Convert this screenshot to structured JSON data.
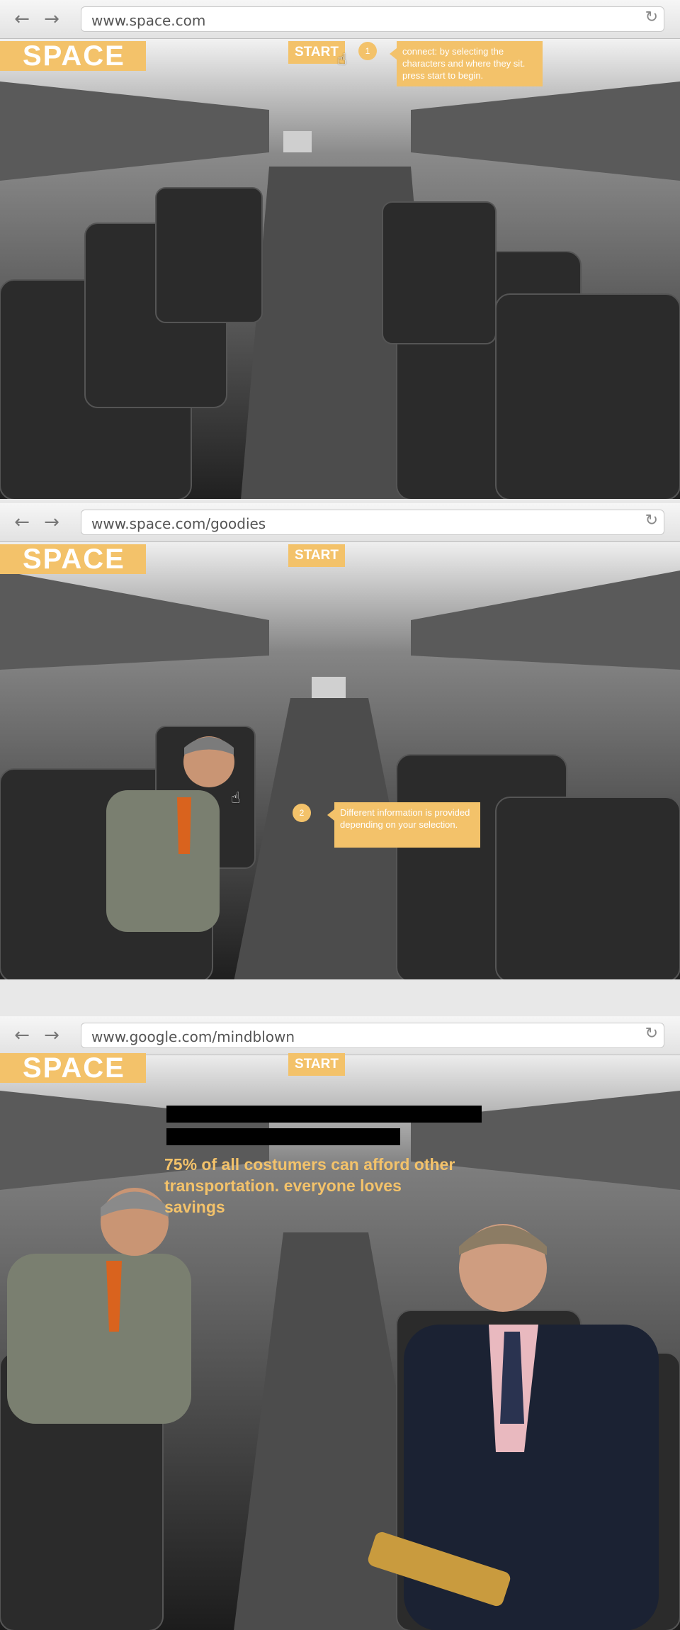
{
  "frames": [
    {
      "url": "www.space.com",
      "logo": "SPACE",
      "start_label": "START",
      "step": "1",
      "tooltip": "connect: by selecting the characters and where they sit. press start to begin."
    },
    {
      "url": "www.space.com/goodies",
      "logo": "SPACE",
      "start_label": "START",
      "step": "2",
      "tooltip": "Different information is provided depending on your selection."
    },
    {
      "url": "www.google.com/mindblown",
      "logo": "SPACE",
      "start_label": "START",
      "message": "75% of all costumers can afford other transportation. everyone loves savings"
    }
  ],
  "icons": {
    "back": "arrow-left",
    "forward": "arrow-right",
    "reload": "reload",
    "cursor": "pointer-hand"
  },
  "colors": {
    "accent": "#f3c26a",
    "scene": "#3a3a3a",
    "redaction": "#000000"
  }
}
